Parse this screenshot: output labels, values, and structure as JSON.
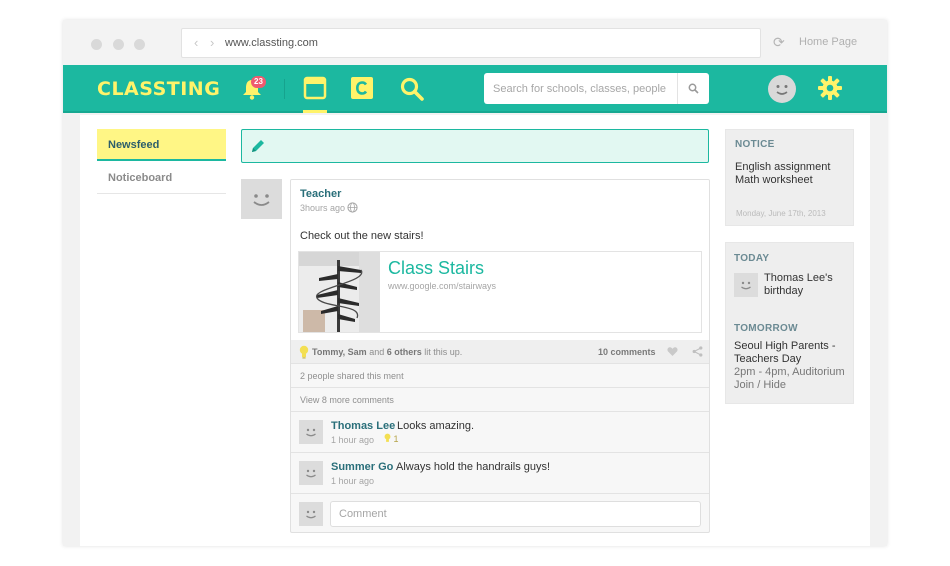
{
  "browser": {
    "url": "www.classting.com",
    "home_link": "Home Page"
  },
  "header": {
    "logo": "CLASSTING",
    "notification_count": "23",
    "search_placeholder": "Search for schools, classes, people",
    "accent_color": "#1cb8a0",
    "logo_color": "#fff36a"
  },
  "sidebar": {
    "items": [
      {
        "label": "Newsfeed",
        "active": true
      },
      {
        "label": "Noticeboard",
        "active": false
      }
    ]
  },
  "post": {
    "author": "Teacher",
    "time": "3hours ago",
    "text": "Check out the new stairs!",
    "link": {
      "title": "Class Stairs",
      "url": "www.google.com/stairways"
    },
    "likes": {
      "names": "Tommy, Sam",
      "and": "and",
      "others": "6 others",
      "suffix": "lit this up."
    },
    "comments_count": "10 comments",
    "shared_text": "2 people shared this ment",
    "more_comments": "View 8 more comments",
    "comments": [
      {
        "name": "Thomas Lee",
        "text": "Looks amazing.",
        "time": "1 hour ago",
        "likes": "1"
      },
      {
        "name": "Summer Go",
        "text": "Always hold the handrails guys!",
        "time": "1 hour ago"
      }
    ],
    "comment_placeholder": "Comment"
  },
  "notice": {
    "heading": "NOTICE",
    "items": [
      "English assignment",
      "Math worksheet"
    ],
    "date": "Monday, June 17th, 2013"
  },
  "today": {
    "heading": "TODAY",
    "event": "Thomas Lee's birthday"
  },
  "tomorrow": {
    "heading": "TOMORROW",
    "event": "Seoul High Parents - Teachers Day",
    "detail": "2pm - 4pm, Auditorium",
    "actions": "Join / Hide"
  }
}
